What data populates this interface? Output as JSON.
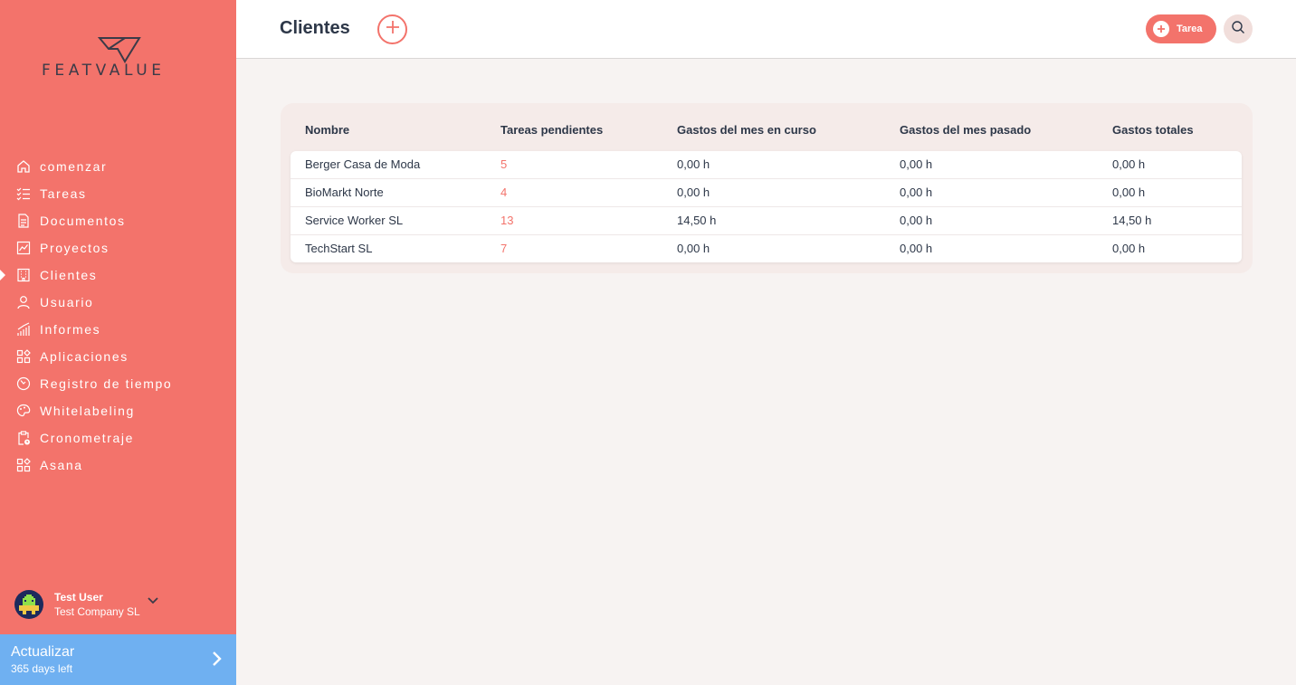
{
  "brand": {
    "name": "FEATVALUE"
  },
  "sidebar": {
    "items": [
      {
        "label": "comenzar",
        "icon": "home-icon"
      },
      {
        "label": "Tareas",
        "icon": "checklist-icon"
      },
      {
        "label": "Documentos",
        "icon": "document-icon"
      },
      {
        "label": "Proyectos",
        "icon": "chart-icon"
      },
      {
        "label": "Clientes",
        "icon": "building-icon",
        "active": true
      },
      {
        "label": "Usuario",
        "icon": "user-icon"
      },
      {
        "label": "Informes",
        "icon": "reports-icon"
      },
      {
        "label": "Aplicaciones",
        "icon": "apps-icon"
      },
      {
        "label": "Registro de tiempo",
        "icon": "timer-icon"
      },
      {
        "label": "Whitelabeling",
        "icon": "palette-icon"
      },
      {
        "label": "Cronometraje",
        "icon": "clipboard-clock-icon"
      },
      {
        "label": "Asana",
        "icon": "apps-icon"
      }
    ],
    "user": {
      "name": "Test User",
      "company": "Test Company SL"
    },
    "upgrade": {
      "title": "Actualizar",
      "subtitle": "365 days left"
    }
  },
  "header": {
    "title": "Clientes",
    "task_button": "Tarea"
  },
  "table": {
    "columns": [
      "Nombre",
      "Tareas pendientes",
      "Gastos del mes en curso",
      "Gastos del mes pasado",
      "Gastos totales"
    ],
    "rows": [
      [
        "Berger Casa de Moda",
        "5",
        "0,00 h",
        "0,00 h",
        "0,00 h"
      ],
      [
        "BioMarkt Norte",
        "4",
        "0,00 h",
        "0,00 h",
        "0,00 h"
      ],
      [
        "Service Worker SL",
        "13",
        "14,50 h",
        "0,00 h",
        "14,50 h"
      ],
      [
        "TechStart SL",
        "7",
        "0,00 h",
        "0,00 h",
        "0,00 h"
      ]
    ]
  },
  "colors": {
    "accent": "#f3736b",
    "upgrade": "#6fb0f1",
    "text": "#2d3748"
  }
}
